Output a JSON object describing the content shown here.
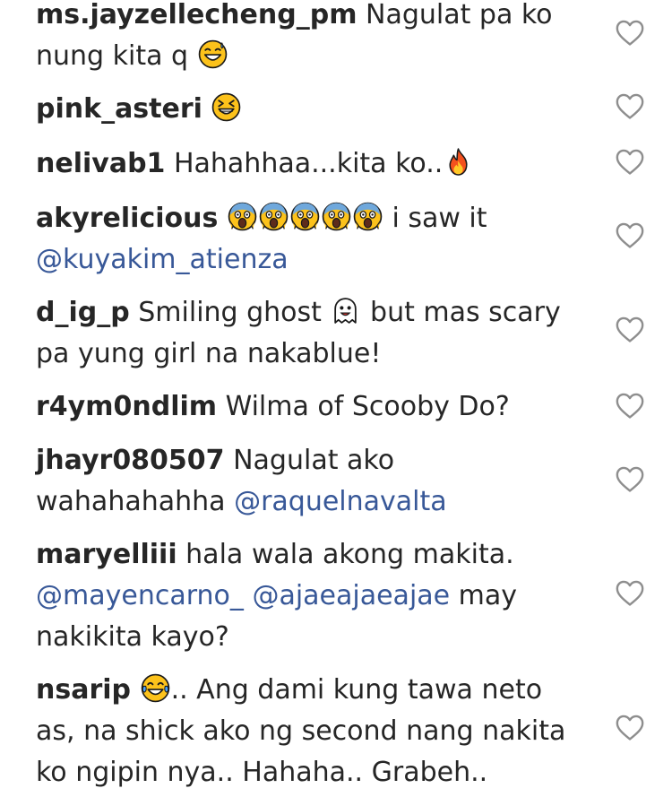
{
  "comments": [
    {
      "username": "ms.jayzellecheng_pm",
      "line1": "Nagulat pa ko",
      "line2": "nung kita q",
      "emoji": "sweat-smile-emoji"
    },
    {
      "username": "pink_asteri",
      "emoji": "laughing-emoji"
    },
    {
      "username": "nelivab1",
      "text": "Hahahhaa...kita ko..",
      "emoji": "fire-emoji"
    },
    {
      "username": "akyrelicious",
      "text_after_emojis": "i saw it",
      "mention": "@kuyakim_atienza",
      "emoji": "scream-emoji",
      "emoji_count": 5
    },
    {
      "username": "d_ig_p",
      "text1": "Smiling ghost",
      "text2": "but mas scary",
      "line2": "pa yung girl na nakablue!",
      "emoji": "ghost-emoji"
    },
    {
      "username": "r4ym0ndlim",
      "text": "Wilma of Scooby Do?"
    },
    {
      "username": "jhayr080507",
      "line1": "Nagulat ako",
      "line2_text": "wahahahahha",
      "mention": "@raquelnavalta"
    },
    {
      "username": "maryelliii",
      "line1": "hala wala akong makita.",
      "mention1": "@mayencarno_",
      "mention2": "@ajaeajaeajae",
      "line2_text": "may",
      "line3": "nakikita kayo?"
    },
    {
      "username": "nsarip",
      "text1": ".. Ang dami kung tawa neto",
      "line2": "as, na shick ako ng second nang nakita",
      "line3": "ko ngipin nya.. Hahaha.. Grabeh..",
      "emoji": "joy-tears-emoji"
    }
  ],
  "icons": {
    "like": "heart-outline-icon"
  },
  "colors": {
    "text": "#262626",
    "mention": "#385898",
    "heart_stroke": "#8e8e8e"
  }
}
